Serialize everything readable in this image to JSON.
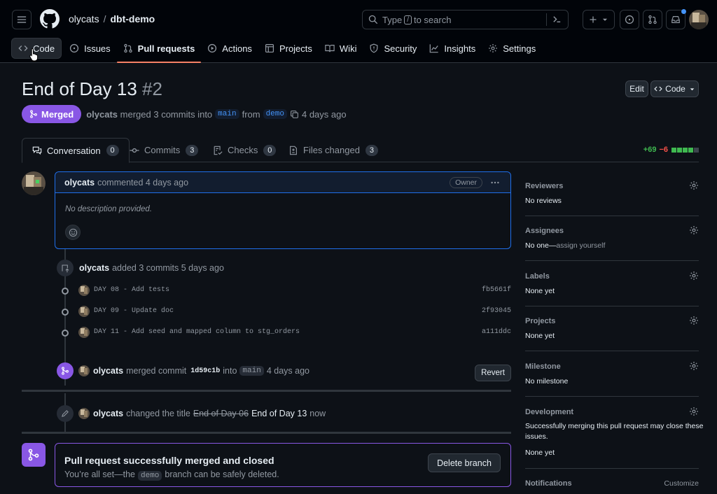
{
  "repo": {
    "owner": "olycats",
    "sep": "/",
    "name": "dbt-demo"
  },
  "search": {
    "prefix": "Type",
    "key": "/",
    "suffix": "to search"
  },
  "nav": [
    {
      "label": "Code"
    },
    {
      "label": "Issues"
    },
    {
      "label": "Pull requests"
    },
    {
      "label": "Actions"
    },
    {
      "label": "Projects"
    },
    {
      "label": "Wiki"
    },
    {
      "label": "Security"
    },
    {
      "label": "Insights"
    },
    {
      "label": "Settings"
    }
  ],
  "pr": {
    "title": "End of Day 13",
    "number": "#2",
    "edit_label": "Edit",
    "code_label": "Code",
    "state": "Merged",
    "author": "olycats",
    "merged_text": "merged 3 commits into",
    "base": "main",
    "from_text": "from",
    "head": "demo",
    "time": "4 days ago"
  },
  "tabs": [
    {
      "label": "Conversation",
      "count": "0"
    },
    {
      "label": "Commits",
      "count": "3"
    },
    {
      "label": "Checks",
      "count": "0"
    },
    {
      "label": "Files changed",
      "count": "3"
    }
  ],
  "diffstat": {
    "additions": "+69",
    "deletions": "−6"
  },
  "comment": {
    "author": "olycats",
    "action": "commented 4 days ago",
    "badge": "Owner",
    "body": "No description provided."
  },
  "commits_event": {
    "author": "olycats",
    "text": "added 3 commits 5 days ago"
  },
  "commits": [
    {
      "message": "DAY 08 - Add tests",
      "sha": "fb5661f"
    },
    {
      "message": "DAY 09 - Update doc",
      "sha": "2f93045"
    },
    {
      "message": "DAY 11 - Add seed and mapped column to stg_orders",
      "sha": "a111ddc"
    }
  ],
  "merge_event": {
    "author": "olycats",
    "text": "merged commit",
    "sha": "1d59c1b",
    "into": "into",
    "branch": "main",
    "time": "4 days ago",
    "revert_label": "Revert"
  },
  "rename_event": {
    "author": "olycats",
    "text": "changed the title",
    "old_title": "End of Day 06",
    "new_title": "End of Day 13",
    "time": "now"
  },
  "merged_box": {
    "title": "Pull request successfully merged and closed",
    "sub_prefix": "You’re all set—the",
    "branch": "demo",
    "sub_suffix": "branch can be safely deleted.",
    "delete_label": "Delete branch"
  },
  "sidebar": {
    "reviewers": {
      "heading": "Reviewers",
      "value": "No reviews"
    },
    "assignees": {
      "heading": "Assignees",
      "value": "No one—",
      "link": "assign yourself"
    },
    "labels": {
      "heading": "Labels",
      "value": "None yet"
    },
    "projects": {
      "heading": "Projects",
      "value": "None yet"
    },
    "milestone": {
      "heading": "Milestone",
      "value": "No milestone"
    },
    "development": {
      "heading": "Development",
      "line1": "Successfully merging this pull request may close these",
      "line2": "issues.",
      "value": "None yet"
    },
    "notifications": {
      "heading": "Notifications",
      "action": "Customize"
    }
  },
  "colors": {
    "accent": "#1f6feb",
    "merged": "#8957e5",
    "underline": "#f78166",
    "added": "#3fb950",
    "deleted": "#f85149"
  }
}
